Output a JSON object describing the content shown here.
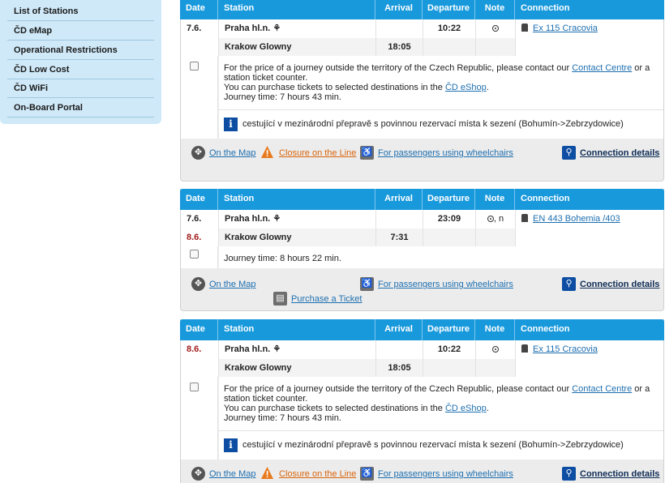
{
  "sidebar": {
    "items": [
      "List of Stations",
      "ČD eMap",
      "Operational Restrictions",
      "ČD Low Cost",
      "ČD WiFi",
      "On-Board Portal"
    ]
  },
  "headers": [
    "Date",
    "Station",
    "Arrival",
    "Departure",
    "Note",
    "Connection"
  ],
  "connections": [
    {
      "date1": "7.6.",
      "from": "Praha hl.n.",
      "dep": "10:22",
      "train": "Ex 115 Cracovia",
      "date2": "",
      "to": "Krakow Glowny",
      "arr": "18:05",
      "note": "",
      "price1": "For the price of a journey outside the territory of the Czech Republic, please contact our ",
      "contact": "Contact Centre",
      "price2": " or a station ticket counter.",
      "eshop1": "You can purchase tickets to selected destinations in the ",
      "eshop": "ČD eShop",
      "eshop2": ".",
      "journey": "Journey time: 7 hours 43 min.",
      "notice": "cestující v mezinárodní přepravě s povinnou rezervací místa k sezení (Bohumín->Zebrzydowice)"
    },
    {
      "date1": "7.6.",
      "from": "Praha hl.n.",
      "dep": "23:09",
      "train": "EN 443 Bohemia /403",
      "date2": "8.6.",
      "to": "Krakow Glowny",
      "arr": "7:31",
      "note": ", n",
      "journey": "Journey time: 8 hours 22 min."
    },
    {
      "date1": "8.6.",
      "from": "Praha hl.n.",
      "dep": "10:22",
      "train": "Ex 115 Cracovia",
      "date2": "",
      "to": "Krakow Glowny",
      "arr": "18:05",
      "note": "",
      "price1": "For the price of a journey outside the territory of the Czech Republic, please contact our ",
      "contact": "Contact Centre",
      "price2": " or a station ticket counter.",
      "eshop1": "You can purchase tickets to selected destinations in the ",
      "eshop": "ČD eShop",
      "eshop2": ".",
      "journey": "Journey time: 7 hours 43 min.",
      "notice": "cestující v mezinárodní přepravě s povinnou rezervací místa k sezení (Bohumín->Zebrzydowice)"
    }
  ],
  "footer": {
    "map": "On the Map",
    "closure": "Closure on the Line",
    "wheelchair": "For passengers using wheelchairs",
    "ticket": "Purchase a Ticket",
    "details": "Connection details"
  },
  "colors": {
    "header": "#1899dc",
    "sidebar": "#cfe9f8",
    "link": "#1e6fb0",
    "warning": "#d9650c"
  }
}
